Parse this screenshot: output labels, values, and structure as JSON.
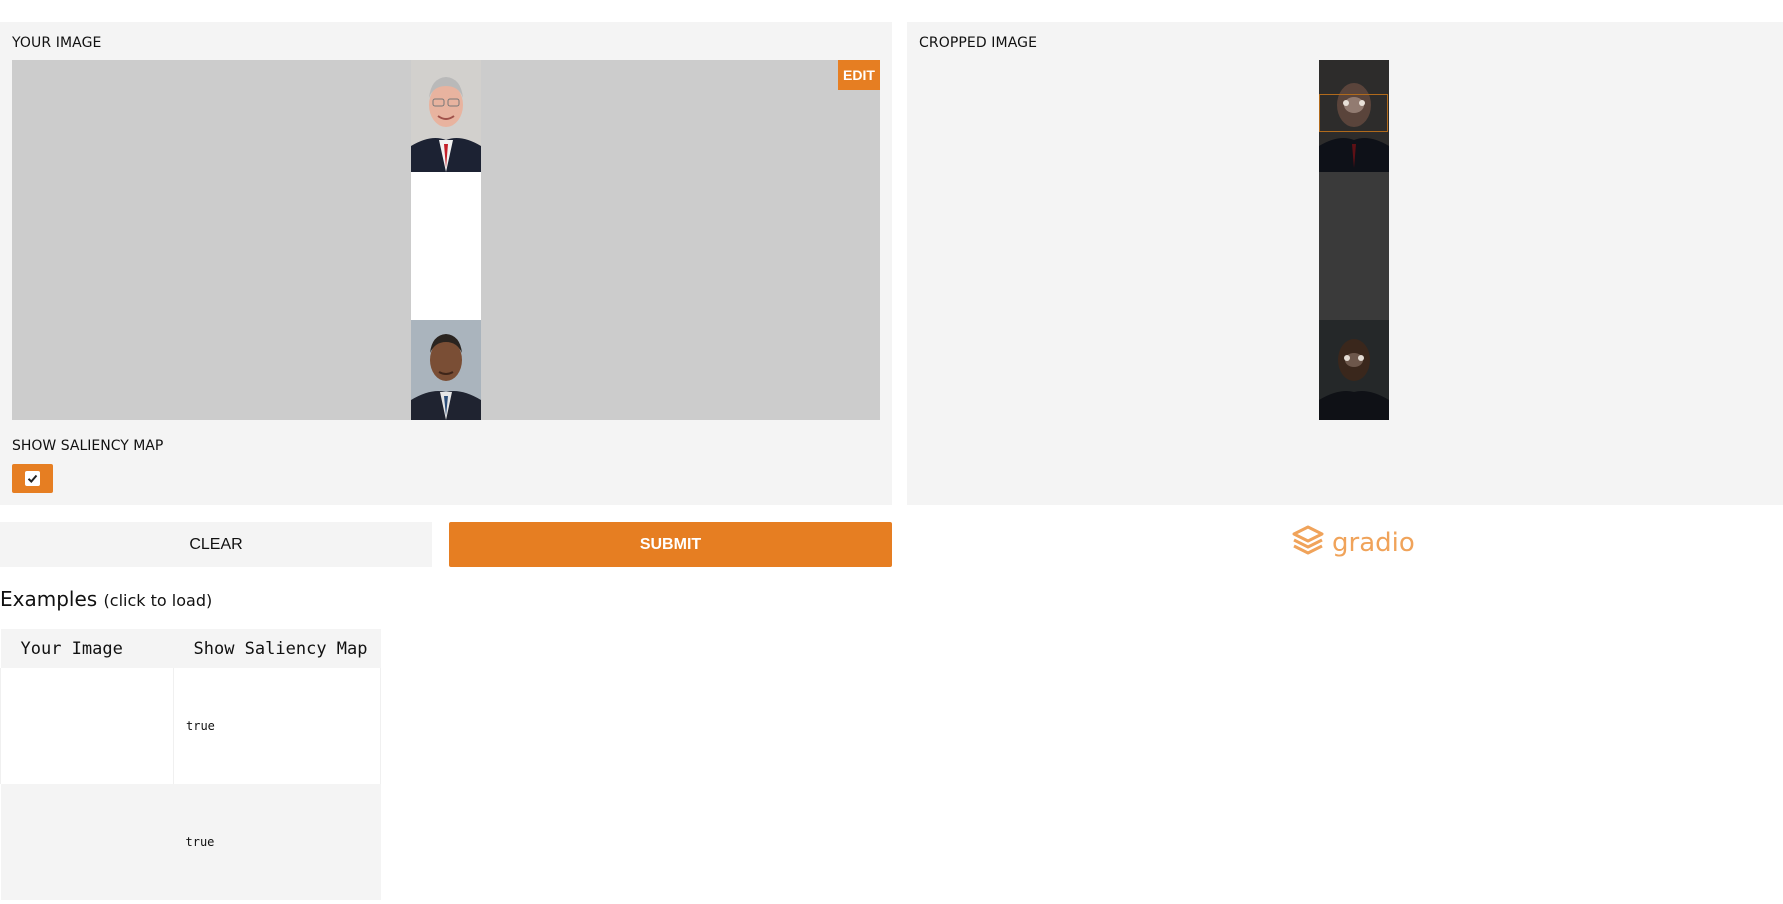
{
  "input_panel": {
    "label": "YOUR IMAGE",
    "edit_label": "EDIT",
    "saliency_label": "SHOW SALIENCY MAP",
    "saliency_checked": true
  },
  "output_panel": {
    "label": "CROPPED IMAGE"
  },
  "buttons": {
    "clear_label": "CLEAR",
    "submit_label": "SUBMIT"
  },
  "branding": {
    "logo_text": "gradio",
    "logo_color": "#f0a35a"
  },
  "examples": {
    "title": "Examples",
    "subtitle": "(click to load)",
    "headers": [
      "Your Image",
      "Show Saliency Map"
    ],
    "rows": [
      {
        "show_saliency_map": "true"
      },
      {
        "show_saliency_map": "true"
      }
    ]
  },
  "colors": {
    "accent": "#e67e22",
    "panel_bg": "#f4f4f4",
    "canvas_bg": "#cccccc"
  }
}
